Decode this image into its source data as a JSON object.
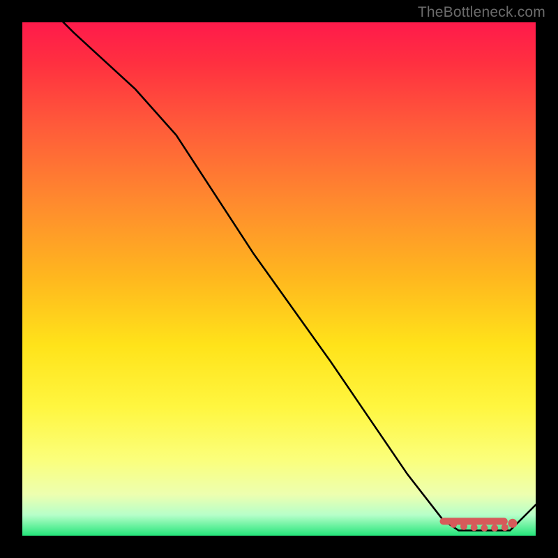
{
  "watermark": "TheBottleneck.com",
  "chart_data": {
    "type": "line",
    "title": "",
    "xlabel": "",
    "ylabel": "",
    "xlim": [
      0,
      100
    ],
    "ylim": [
      0,
      100
    ],
    "series": [
      {
        "name": "curve",
        "x": [
          0,
          10,
          22,
          30,
          45,
          60,
          75,
          82,
          85,
          90,
          95,
          100
        ],
        "y": [
          108,
          98,
          87,
          78,
          55,
          34,
          12,
          3,
          1,
          1,
          1,
          6
        ]
      }
    ],
    "markers": {
      "name": "points",
      "x": [
        82,
        84,
        86,
        88,
        90,
        92,
        94,
        95.5
      ],
      "y": [
        2.8,
        2.2,
        1.8,
        1.6,
        1.5,
        1.5,
        1.6,
        2.4
      ]
    },
    "colors": {
      "curve": "#000000",
      "marker": "#d65a5a"
    }
  }
}
